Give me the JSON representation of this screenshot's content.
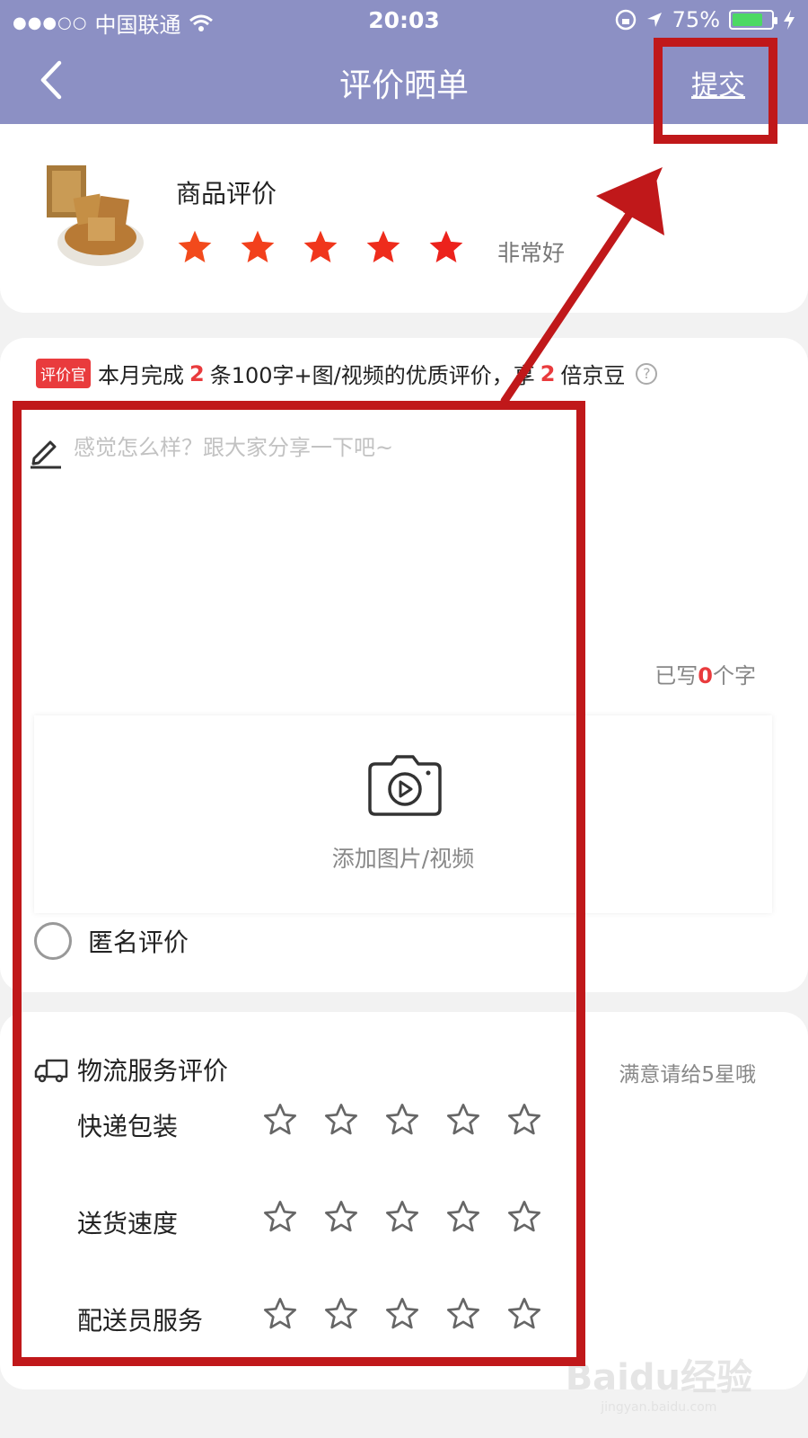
{
  "status": {
    "carrier": "中国联通",
    "time": "20:03",
    "battery": "75%",
    "battery_level": 0.75
  },
  "nav": {
    "title": "评价晒单",
    "submit_label": "提交"
  },
  "product": {
    "label": "商品评价",
    "rating": 5,
    "rating_text": "非常好",
    "star_color": "#f03c1e"
  },
  "promo": {
    "tag": "评价官",
    "text_prefix": "本月完成",
    "count": "2",
    "text_middle": "条100字+图/视频的优质评价，享",
    "multiplier": "2",
    "text_suffix": "倍京豆",
    "help": "?"
  },
  "review": {
    "placeholder": "感觉怎么样？跟大家分享一下吧~",
    "count_prefix": "已写",
    "count_value": "0",
    "count_suffix": "个字"
  },
  "upload": {
    "label": "添加图片/视频"
  },
  "anonymous": {
    "label": "匿名评价"
  },
  "logistics": {
    "title": "物流服务评价",
    "hint": "满意请给5星哦",
    "rows": [
      {
        "label": "快递包装",
        "rating": 0
      },
      {
        "label": "送货速度",
        "rating": 0
      },
      {
        "label": "配送员服务",
        "rating": 0
      }
    ]
  },
  "watermark": {
    "brand": "Baidu经验",
    "url": "jingyan.baidu.com"
  },
  "colors": {
    "header": "#8c90c4",
    "accent_red": "#e93b3d",
    "annotation_red": "#c0181a"
  }
}
